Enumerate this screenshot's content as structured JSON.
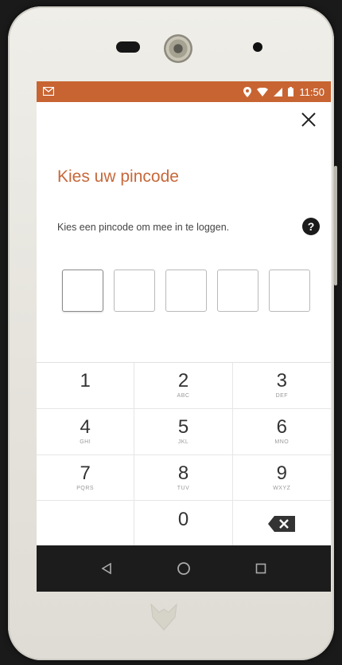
{
  "status_bar": {
    "notification_icon": "gmail-icon",
    "time": "11:50",
    "icons": [
      "location-icon",
      "wifi-icon",
      "signal-icon",
      "battery-icon"
    ]
  },
  "app": {
    "title": "Kies uw pincode",
    "subtitle": "Kies een pincode om mee in te loggen.",
    "help_label": "?",
    "pin_length": 5
  },
  "keypad": {
    "keys": [
      {
        "num": "1",
        "letters": ""
      },
      {
        "num": "2",
        "letters": "ABC"
      },
      {
        "num": "3",
        "letters": "DEF"
      },
      {
        "num": "4",
        "letters": "GHI"
      },
      {
        "num": "5",
        "letters": "JKL"
      },
      {
        "num": "6",
        "letters": "MNO"
      },
      {
        "num": "7",
        "letters": "PQRS"
      },
      {
        "num": "8",
        "letters": "TUV"
      },
      {
        "num": "9",
        "letters": "WXYZ"
      },
      {
        "num": "",
        "letters": ""
      },
      {
        "num": "0",
        "letters": ""
      },
      {
        "num": "",
        "letters": ""
      }
    ]
  },
  "navigation": [
    "back-icon",
    "home-icon",
    "recents-icon"
  ],
  "colors": {
    "accent": "#c86432",
    "title": "#c7683a",
    "nav_bar": "#1c1c1c"
  }
}
